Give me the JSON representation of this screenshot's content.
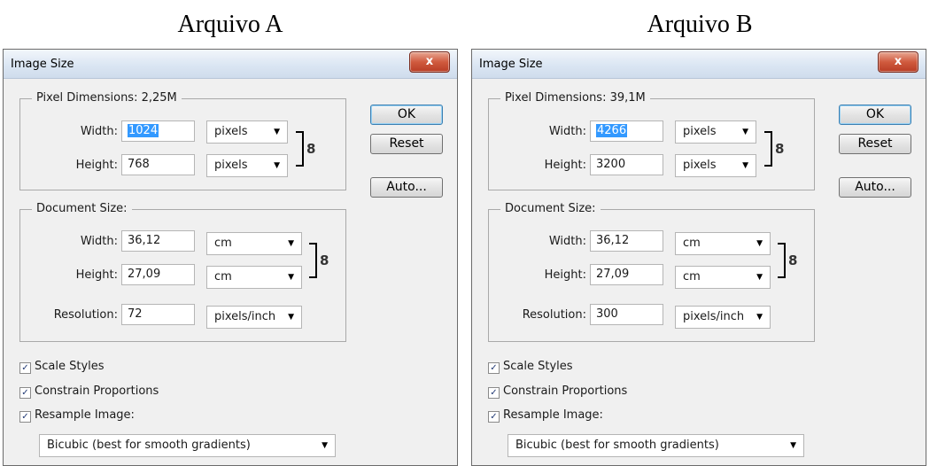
{
  "captions": [
    "Arquivo A",
    "Arquivo B"
  ],
  "dialogs": [
    {
      "title": "Image Size",
      "close_glyph": "x",
      "pixel_dimensions_label": "Pixel Dimensions:  2,25M",
      "pixel": {
        "width_label": "Width:",
        "width_value": "1024",
        "width_unit": "pixels",
        "height_label": "Height:",
        "height_value": "768",
        "height_unit": "pixels"
      },
      "document_size_label": "Document Size:",
      "document": {
        "width_label": "Width:",
        "width_value": "36,12",
        "width_unit": "cm",
        "height_label": "Height:",
        "height_value": "27,09",
        "height_unit": "cm",
        "resolution_label": "Resolution:",
        "resolution_value": "72",
        "resolution_unit": "pixels/inch"
      },
      "buttons": {
        "ok": "OK",
        "reset": "Reset",
        "auto": "Auto..."
      },
      "checkboxes": {
        "scale_styles": "Scale Styles",
        "constrain": "Constrain Proportions",
        "resample": "Resample Image:"
      },
      "resample_method": "Bicubic (best for smooth gradients)"
    },
    {
      "title": "Image Size",
      "close_glyph": "x",
      "pixel_dimensions_label": "Pixel Dimensions:  39,1M",
      "pixel": {
        "width_label": "Width:",
        "width_value": "4266",
        "width_unit": "pixels",
        "height_label": "Height:",
        "height_value": "3200",
        "height_unit": "pixels"
      },
      "document_size_label": "Document Size:",
      "document": {
        "width_label": "Width:",
        "width_value": "36,12",
        "width_unit": "cm",
        "height_label": "Height:",
        "height_value": "27,09",
        "height_unit": "cm",
        "resolution_label": "Resolution:",
        "resolution_value": "300",
        "resolution_unit": "pixels/inch"
      },
      "buttons": {
        "ok": "OK",
        "reset": "Reset",
        "auto": "Auto..."
      },
      "checkboxes": {
        "scale_styles": "Scale Styles",
        "constrain": "Constrain Proportions",
        "resample": "Resample Image:"
      },
      "resample_method": "Bicubic (best for smooth gradients)"
    }
  ]
}
